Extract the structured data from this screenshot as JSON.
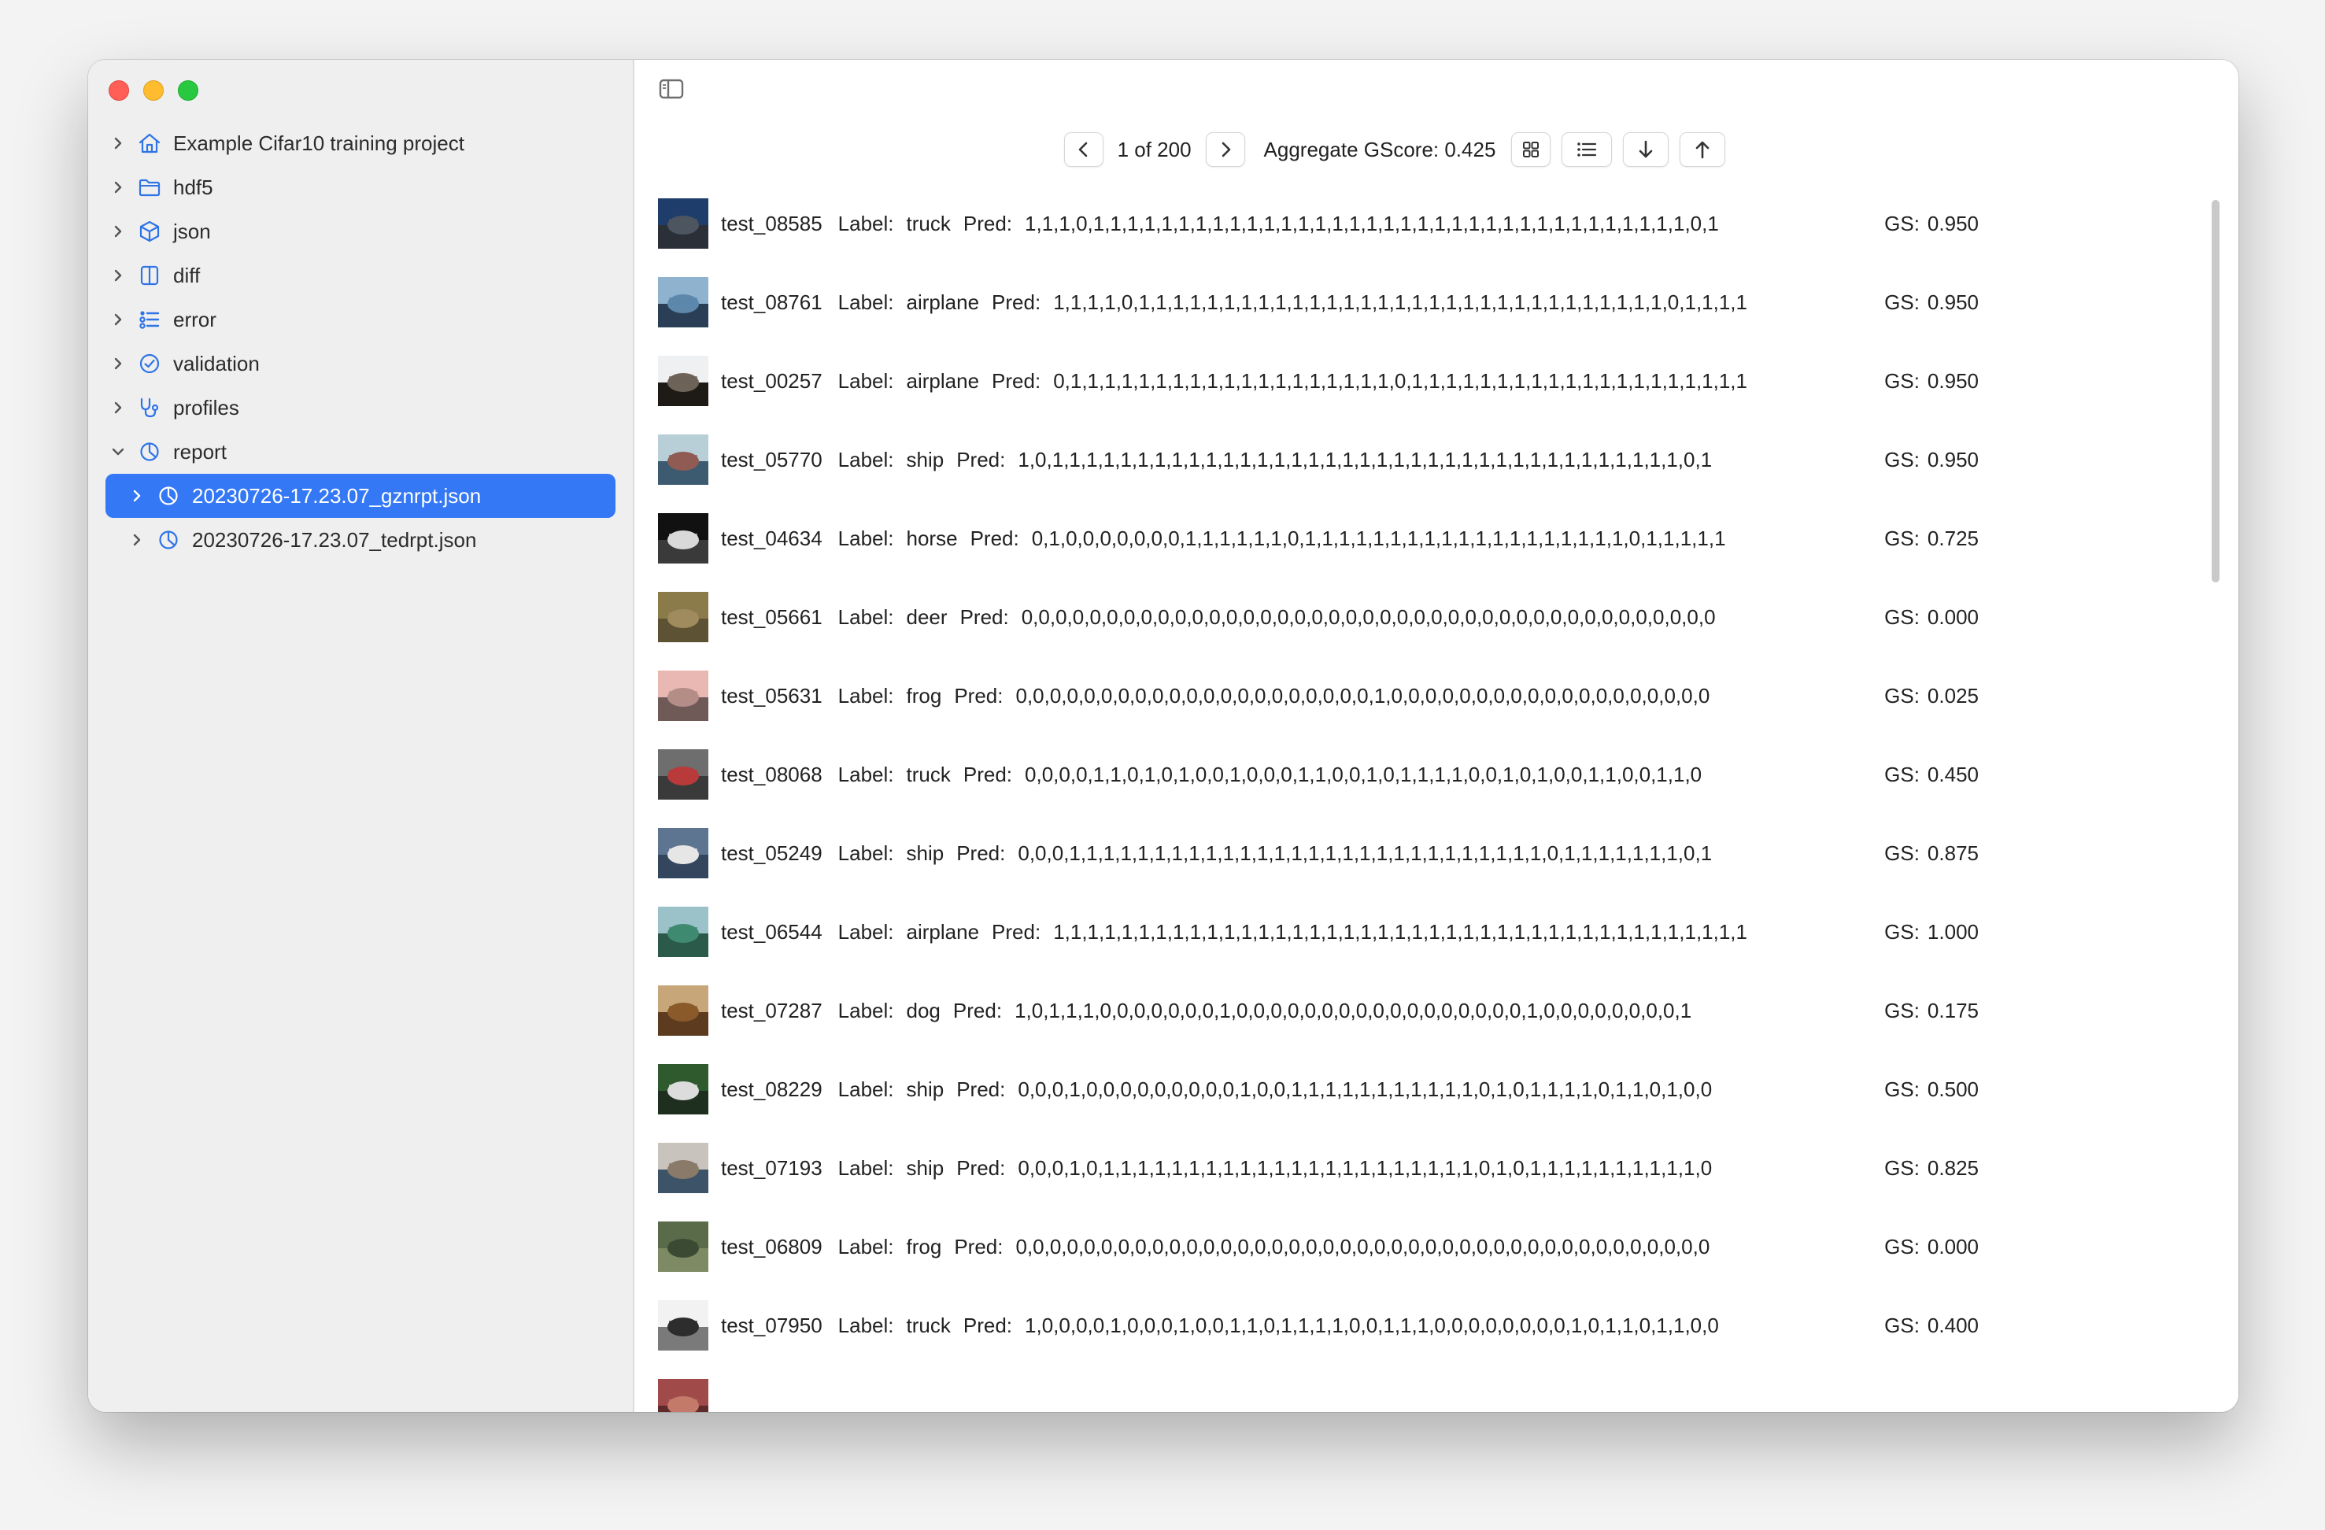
{
  "sidebar": {
    "items": [
      {
        "label": "Example Cifar10 training project",
        "icon": "house-icon",
        "expanded": false
      },
      {
        "label": "hdf5",
        "icon": "folder-icon",
        "expanded": false
      },
      {
        "label": "json",
        "icon": "cube-icon",
        "expanded": false
      },
      {
        "label": "diff",
        "icon": "split-view-icon",
        "expanded": false
      },
      {
        "label": "error",
        "icon": "checklist-icon",
        "expanded": false
      },
      {
        "label": "validation",
        "icon": "checkmark-circle-icon",
        "expanded": false
      },
      {
        "label": "profiles",
        "icon": "stethoscope-icon",
        "expanded": false
      },
      {
        "label": "report",
        "icon": "chart-pie-icon",
        "expanded": true
      },
      {
        "label": "20230726-17.23.07_gznrpt.json",
        "icon": "chart-pie-icon",
        "expanded": false,
        "selected": true
      },
      {
        "label": "20230726-17.23.07_tedrpt.json",
        "icon": "chart-pie-icon",
        "expanded": false
      }
    ]
  },
  "toolbar": {
    "page_indicator": "1 of 200",
    "aggregate": "Aggregate GScore: 0.425",
    "prev_icon": "chevron-left-icon",
    "next_icon": "chevron-right-icon",
    "grid_icon": "grid-icon",
    "list_icon": "list-icon",
    "sort_desc_icon": "arrow-down-icon",
    "sort_asc_icon": "arrow-up-icon"
  },
  "labels": {
    "label_key": "Label:",
    "pred_key": "Pred:",
    "gs_key": "GS:"
  },
  "rows": [
    {
      "name": "test_08585",
      "label": "truck",
      "pred": "1,1,1,0,1,1,1,1,1,1,1,1,1,1,1,1,1,1,1,1,1,1,1,1,1,1,1,1,1,1,1,1,1,1,1,1,1,1,1,0,1",
      "gs": "0.950",
      "thumb": [
        "#1f3d6a",
        "#4d5560",
        "#2b2f38"
      ]
    },
    {
      "name": "test_08761",
      "label": "airplane",
      "pred": "1,1,1,1,0,1,1,1,1,1,1,1,1,1,1,1,1,1,1,1,1,1,1,1,1,1,1,1,1,1,1,1,1,1,1,1,0,1,1,1,1",
      "gs": "0.950",
      "thumb": [
        "#8fb3cf",
        "#5d88ac",
        "#2a3f55"
      ]
    },
    {
      "name": "test_00257",
      "label": "airplane",
      "pred": "0,1,1,1,1,1,1,1,1,1,1,1,1,1,1,1,1,1,1,1,0,1,1,1,1,1,1,1,1,1,1,1,1,1,1,1,1,1,1,1,1",
      "gs": "0.950",
      "thumb": [
        "#eef0f2",
        "#6d6358",
        "#1e1a16"
      ]
    },
    {
      "name": "test_05770",
      "label": "ship",
      "pred": "1,0,1,1,1,1,1,1,1,1,1,1,1,1,1,1,1,1,1,1,1,1,1,1,1,1,1,1,1,1,1,1,1,1,1,1,1,1,1,0,1",
      "gs": "0.950",
      "thumb": [
        "#b9cfd8",
        "#8f5b52",
        "#3c5b70"
      ]
    },
    {
      "name": "test_04634",
      "label": "horse",
      "pred": "0,1,0,0,0,0,0,0,0,1,1,1,1,1,1,0,1,1,1,1,1,1,1,1,1,1,1,1,1,1,1,1,1,1,1,0,1,1,1,1,1",
      "gs": "0.725",
      "thumb": [
        "#111111",
        "#d9d9d9",
        "#3a3a3a"
      ]
    },
    {
      "name": "test_05661",
      "label": "deer",
      "pred": "0,0,0,0,0,0,0,0,0,0,0,0,0,0,0,0,0,0,0,0,0,0,0,0,0,0,0,0,0,0,0,0,0,0,0,0,0,0,0,0,0",
      "gs": "0.000",
      "thumb": [
        "#8b7a4a",
        "#a08b5e",
        "#5d5234"
      ]
    },
    {
      "name": "test_05631",
      "label": "frog",
      "pred": "0,0,0,0,0,0,0,0,0,0,0,0,0,0,0,0,0,0,0,0,0,1,0,0,0,0,0,0,0,0,0,0,0,0,0,0,0,0,0,0,0",
      "gs": "0.025",
      "thumb": [
        "#e9b8b3",
        "#b48d88",
        "#6f5a58"
      ]
    },
    {
      "name": "test_08068",
      "label": "truck",
      "pred": "0,0,0,0,1,1,0,1,0,1,0,0,1,0,0,0,1,1,0,0,1,0,1,1,1,1,0,0,1,0,1,0,0,1,1,0,0,1,1,0",
      "gs": "0.450",
      "thumb": [
        "#6e6e6e",
        "#b83a3a",
        "#3a3a3a"
      ]
    },
    {
      "name": "test_05249",
      "label": "ship",
      "pred": "0,0,0,1,1,1,1,1,1,1,1,1,1,1,1,1,1,1,1,1,1,1,1,1,1,1,1,1,1,1,1,0,1,1,1,1,1,1,1,0,1",
      "gs": "0.875",
      "thumb": [
        "#5d7590",
        "#e6e6e6",
        "#34465e"
      ]
    },
    {
      "name": "test_06544",
      "label": "airplane",
      "pred": "1,1,1,1,1,1,1,1,1,1,1,1,1,1,1,1,1,1,1,1,1,1,1,1,1,1,1,1,1,1,1,1,1,1,1,1,1,1,1,1,1",
      "gs": "1.000",
      "thumb": [
        "#9bc2c9",
        "#3f8a70",
        "#2b5a4b"
      ]
    },
    {
      "name": "test_07287",
      "label": "dog",
      "pred": "1,0,1,1,1,0,0,0,0,0,0,0,1,0,0,0,0,0,0,0,0,0,0,0,0,0,0,0,0,0,1,0,0,0,0,0,0,0,0,1",
      "gs": "0.175",
      "thumb": [
        "#c7a77a",
        "#8a5a2a",
        "#5c3b1f"
      ]
    },
    {
      "name": "test_08229",
      "label": "ship",
      "pred": "0,0,0,1,0,0,0,0,0,0,0,0,0,1,0,0,1,1,1,1,1,1,1,1,1,1,1,0,1,0,1,1,1,1,0,1,1,0,1,0,0",
      "gs": "0.500",
      "thumb": [
        "#2e5a2e",
        "#dcdcdc",
        "#1f2f1f"
      ]
    },
    {
      "name": "test_07193",
      "label": "ship",
      "pred": "0,0,0,1,0,1,1,1,1,1,1,1,1,1,1,1,1,1,1,1,1,1,1,1,1,1,1,0,1,0,1,1,1,1,1,1,1,1,1,1,0",
      "gs": "0.825",
      "thumb": [
        "#c8c3bd",
        "#8a7a6a",
        "#3d5468"
      ]
    },
    {
      "name": "test_06809",
      "label": "frog",
      "pred": "0,0,0,0,0,0,0,0,0,0,0,0,0,0,0,0,0,0,0,0,0,0,0,0,0,0,0,0,0,0,0,0,0,0,0,0,0,0,0,0,0",
      "gs": "0.000",
      "thumb": [
        "#5a6b4a",
        "#3b4a33",
        "#7d8a63"
      ]
    },
    {
      "name": "test_07950",
      "label": "truck",
      "pred": "1,0,0,0,0,1,0,0,0,1,0,0,1,1,0,1,1,1,1,0,0,1,1,1,0,0,0,0,0,0,0,0,1,0,1,1,0,1,1,0,0",
      "gs": "0.400",
      "thumb": [
        "#f2f2f2",
        "#2d2d2d",
        "#7a7a7a"
      ]
    }
  ],
  "partial_row_thumb": [
    "#a04a4a",
    "#c47a6a",
    "#602a2a"
  ]
}
